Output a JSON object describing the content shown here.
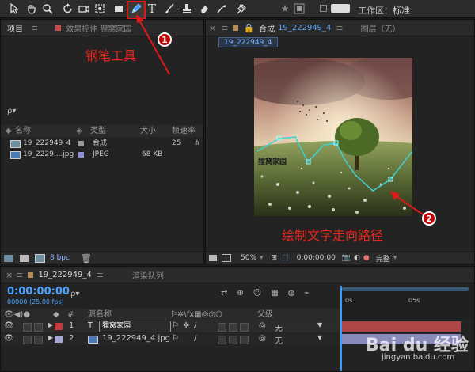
{
  "toolbar": {
    "tools": [
      {
        "id": "selection",
        "icon": "arrow-icon"
      },
      {
        "id": "hand",
        "icon": "hand-icon"
      },
      {
        "id": "zoom",
        "icon": "zoom-icon"
      },
      {
        "id": "rotate",
        "icon": "rotate-icon"
      },
      {
        "id": "camera",
        "icon": "camera-icon"
      },
      {
        "id": "pan-behind",
        "icon": "pan-behind-icon"
      },
      {
        "id": "rectangle",
        "icon": "rectangle-icon"
      },
      {
        "id": "pen",
        "icon": "pen-icon"
      },
      {
        "id": "type",
        "icon": "type-icon",
        "glyph": "T"
      },
      {
        "id": "brush",
        "icon": "brush-icon"
      },
      {
        "id": "clone-stamp",
        "icon": "stamp-icon"
      },
      {
        "id": "eraser",
        "icon": "eraser-icon"
      },
      {
        "id": "roto-brush",
        "icon": "roto-icon"
      },
      {
        "id": "puppet",
        "icon": "puppet-icon"
      }
    ],
    "workspace_label": "工作区：",
    "workspace_value": "标准"
  },
  "project_panel": {
    "tab_label": "项目",
    "effects_tab_label": "效果控件 狸窝家园",
    "search_placeholder": "ρ▾",
    "columns": [
      "名称",
      "类型",
      "大小",
      "帧速率"
    ],
    "items": [
      {
        "name": "19_222949_4",
        "type": "合成",
        "size": "",
        "fps": "25",
        "color": "#9a9a9a"
      },
      {
        "name": "19_2229....jpg",
        "type": "JPEG",
        "size": "68 KB",
        "fps": "",
        "color": "#8f8fd8"
      }
    ],
    "bpc_label": "8 bpc"
  },
  "comp_panel": {
    "tab_label": "合成",
    "comp_name": "19_222949_4",
    "layer_tab_label": "图层（无）",
    "comp_chip": "19_222949_4",
    "zoom": "50%",
    "timecode": "0:00:00:00",
    "quality": "完整",
    "watermark_text": "狸窝家园"
  },
  "annotations": {
    "pen_tool_label": "钢笔工具",
    "path_label": "绘制文字走向路径",
    "badge1": "1",
    "badge2": "2"
  },
  "timeline_panel": {
    "comp_tab": "19_222949_4",
    "render_tab": "渲染队列",
    "timecode": "0:00:00:00",
    "fps": "00000 (25.00 fps)",
    "search_placeholder": "ρ▾",
    "col_number": "#",
    "col_source": "源名称",
    "col_parent": "父级",
    "ruler_start": "0s",
    "ruler_mid": "05s",
    "layers": [
      {
        "index": "1",
        "name": "狸窝家园",
        "kind": "text",
        "color": "#c43a3a",
        "parent": "无"
      },
      {
        "index": "2",
        "name": "19_222949_4.jpg",
        "kind": "image",
        "color": "#a8a8d8",
        "parent": "无"
      }
    ]
  },
  "watermark": {
    "brand": "Bai du 经验",
    "url": "jingyan.baidu.com"
  }
}
